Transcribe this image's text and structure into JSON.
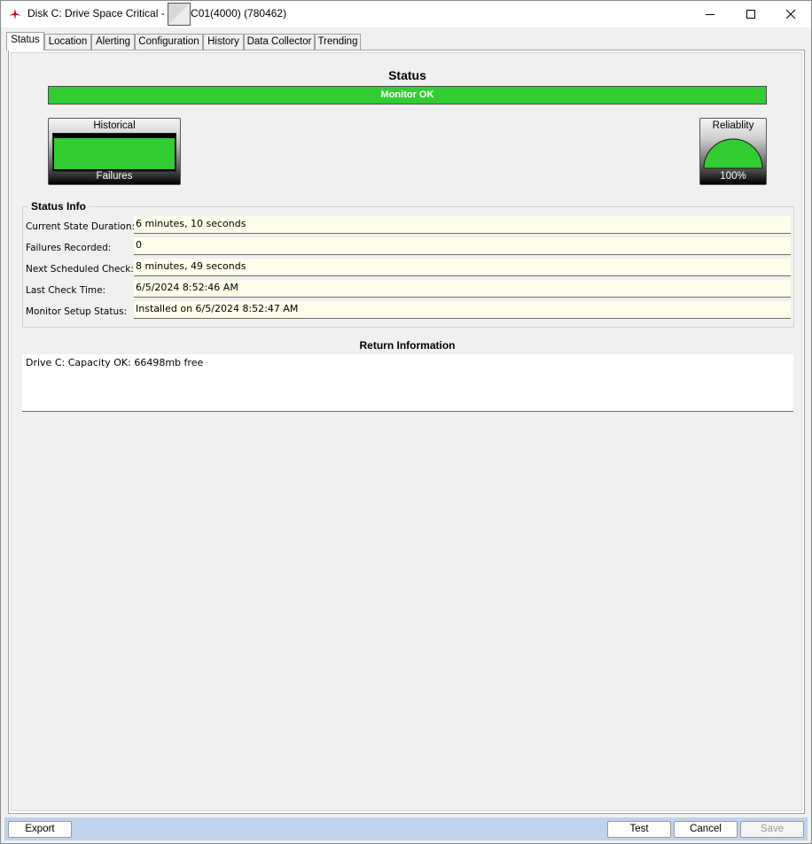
{
  "window": {
    "title_prefix": "Disk C: Drive Space Critical - ",
    "title_suffix": "C01(4000) (780462)"
  },
  "tabs": [
    {
      "label": "Status"
    },
    {
      "label": "Location"
    },
    {
      "label": "Alerting"
    },
    {
      "label": "Configuration"
    },
    {
      "label": "History"
    },
    {
      "label": "Data Collector"
    },
    {
      "label": "Trending"
    }
  ],
  "status": {
    "title": "Status",
    "state": "Monitor OK",
    "state_color": "#33cc33"
  },
  "historical_gauge": {
    "title": "Historical",
    "footer": "Failures"
  },
  "reliability_gauge": {
    "title": "Reliablity",
    "value": "100%",
    "fraction": 1.0
  },
  "status_info": {
    "title": "Status Info",
    "rows": [
      {
        "label": "Current State Duration:",
        "value": "6 minutes, 10 seconds"
      },
      {
        "label": "Failures Recorded:",
        "value": "0"
      },
      {
        "label": "Next Scheduled Check:",
        "value": "8 minutes, 49 seconds"
      },
      {
        "label": "Last Check Time:",
        "value": "6/5/2024 8:52:46 AM"
      },
      {
        "label": "Monitor Setup Status:",
        "value": "Installed on 6/5/2024 8:52:47 AM"
      }
    ]
  },
  "return_info": {
    "title": "Return Information",
    "text": "Drive C: Capacity OK: 66498mb free"
  },
  "buttons": {
    "export": "Export",
    "test": "Test",
    "cancel": "Cancel",
    "save": "Save"
  },
  "colors": {
    "ok_green": "#33cc33",
    "value_bg": "#fdfde9",
    "bottom_bar": "#bfd3ec"
  }
}
